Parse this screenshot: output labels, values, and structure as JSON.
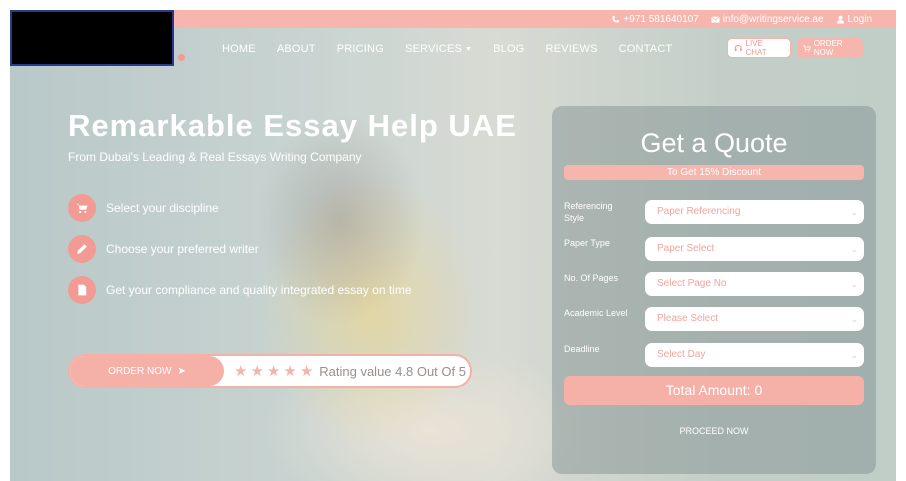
{
  "topbar": {
    "phone": "+971 581640107",
    "email": "info@writingservice.ae",
    "login": "Login"
  },
  "nav": {
    "items": [
      "HOME",
      "ABOUT",
      "PRICING",
      "SERVICES",
      "BLOG",
      "REVIEWS",
      "CONTACT"
    ],
    "live_chat": "LIVE CHAT",
    "order_now": "ORDER NOW"
  },
  "hero": {
    "title": "Remarkable Essay Help UAE",
    "subtitle": "From Dubai's Leading & Real Essays Writing Company",
    "features": [
      "Select your discipline",
      "Choose your preferred writer",
      "Get your compliance and quality integrated essay on time"
    ],
    "order_button": "ORDER NOW",
    "rating_text": "Rating value 4.8 Out Of 5",
    "stars": 5
  },
  "quote": {
    "title": "Get a Quote",
    "discount": "To Get 15% Discount",
    "fields": [
      {
        "label": "Referencing Style",
        "value": "Paper Referencing"
      },
      {
        "label": "Paper Type",
        "value": "Paper Select"
      },
      {
        "label": "No. Of Pages",
        "value": "Select Page No"
      },
      {
        "label": "Academic Level",
        "value": "Please Select"
      },
      {
        "label": "Deadline",
        "value": "Select Day"
      }
    ],
    "total": "Total Amount: 0",
    "proceed": "PROCEED NOW"
  },
  "colors": {
    "accent": "#f5b0a8",
    "accent_dark": "#f29b94",
    "topbar": "#f6b5ad"
  },
  "icons": {
    "phone": "phone-icon",
    "email": "envelope-icon",
    "login": "user-icon",
    "chat": "headset-icon",
    "cart": "cart-icon",
    "arrow": "arrow-right-icon",
    "star": "star-icon"
  }
}
